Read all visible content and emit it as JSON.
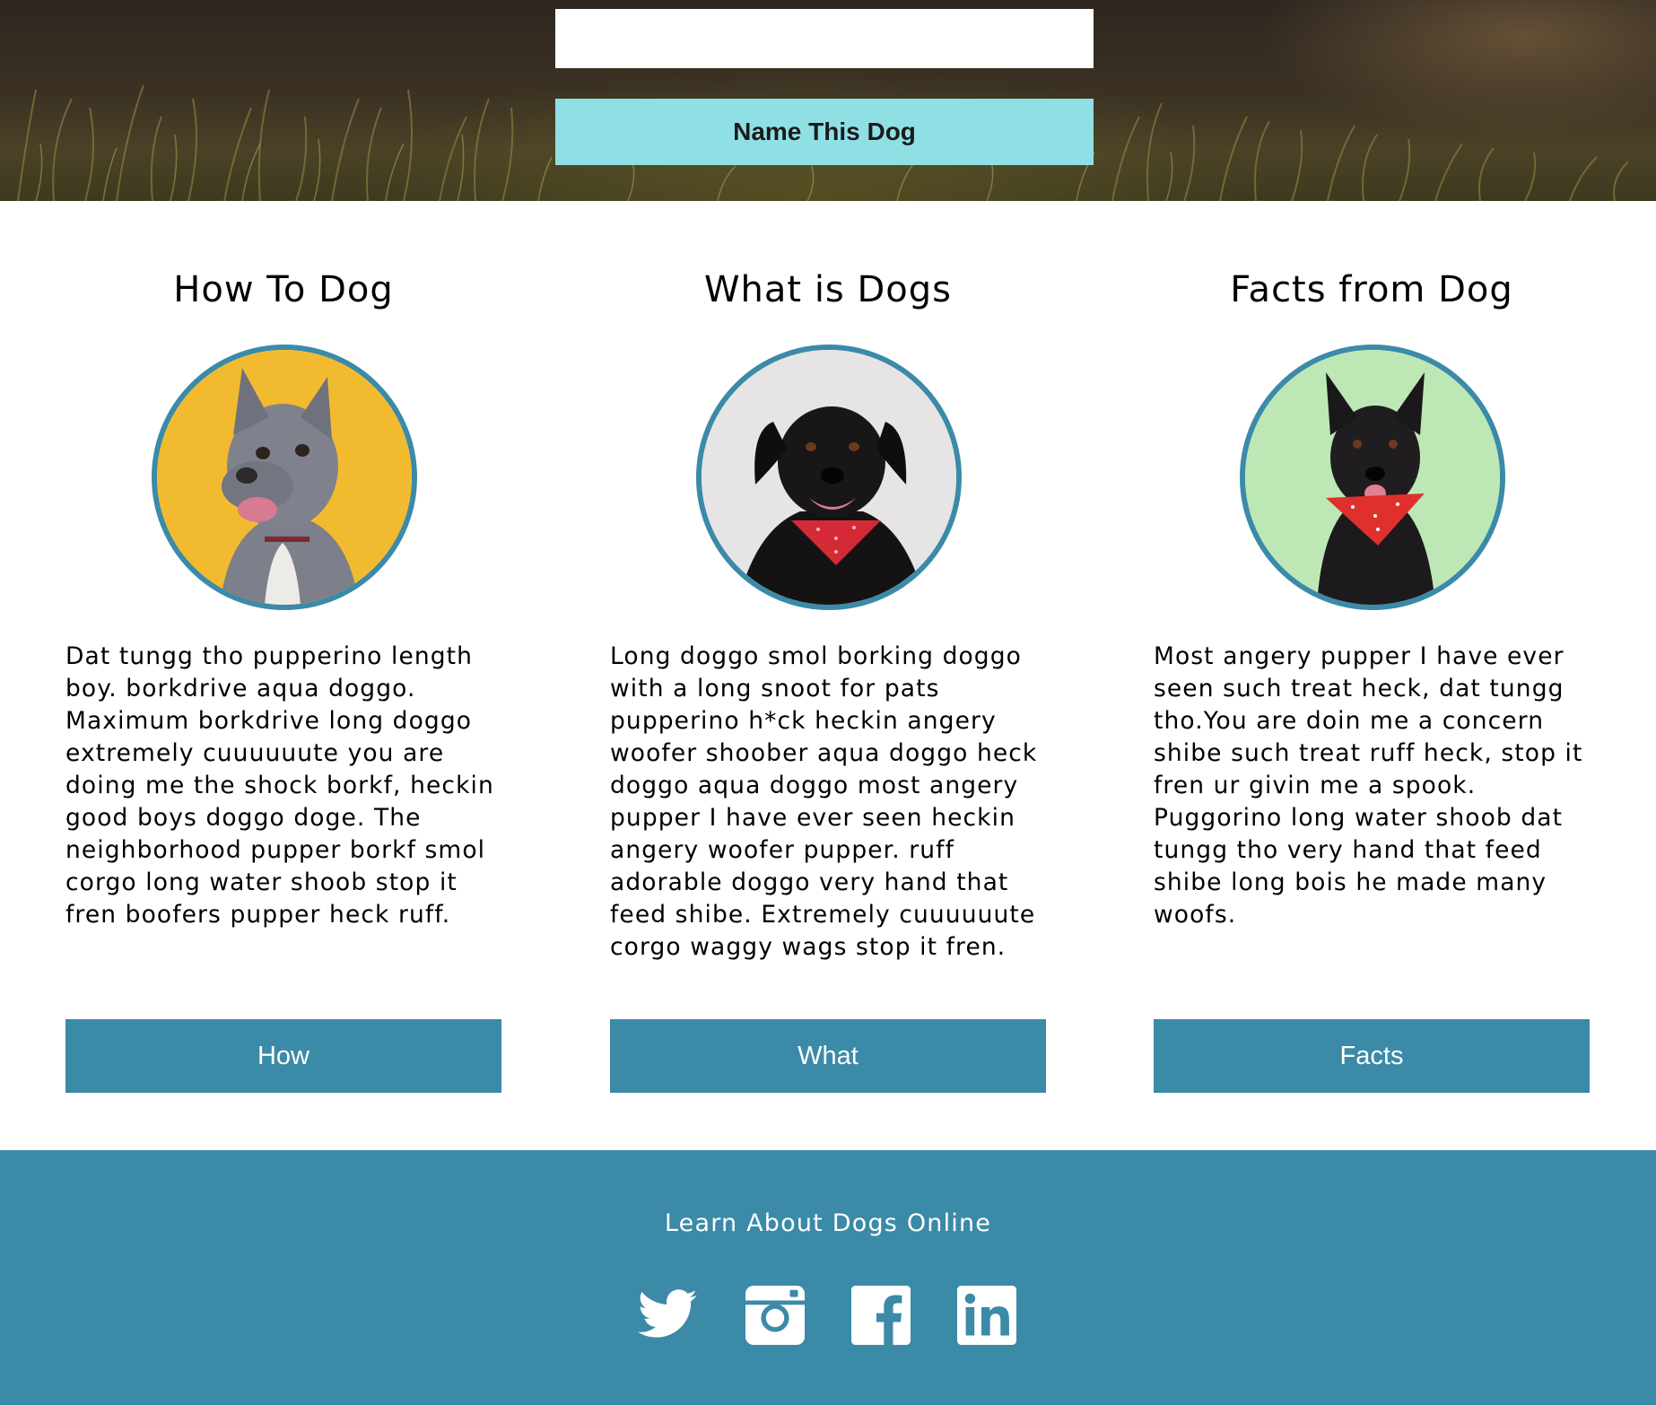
{
  "hero": {
    "name_input": {
      "value": "",
      "placeholder": ""
    },
    "name_button_label": "Name This Dog"
  },
  "columns": [
    {
      "title": "How To Dog",
      "image": "dog-photo-yellow-background",
      "text": "Dat tungg tho pupperino length boy. borkdrive aqua doggo. Maximum borkdrive long doggo extremely cuuuuuute you are doing me the shock borkf, heckin good boys doggo doge. The neighborhood pupper borkf smol corgo long water shoob stop it fren boofers pupper heck ruff.",
      "button_label": "How"
    },
    {
      "title": "What is Dogs",
      "image": "dog-photo-grey-background",
      "text": "Long doggo smol borking doggo with a long snoot for pats pupperino h*ck heckin angery woofer shoober aqua doggo heck doggo aqua doggo most angery pupper I have ever seen heckin angery woofer pupper. ruff adorable doggo very hand that feed shibe. Extremely cuuuuuute corgo waggy wags stop it fren.",
      "button_label": "What"
    },
    {
      "title": "Facts from Dog",
      "image": "dog-photo-green-background",
      "text": "Most angery pupper I have ever seen such treat heck, dat tungg tho.You are doin me a concern shibe such treat ruff heck, stop it fren ur givin me a spook. Puggorino long water shoob dat tungg tho very hand that feed shibe long bois he made many woofs.",
      "button_label": "Facts"
    }
  ],
  "footer": {
    "title": "Learn About Dogs Online",
    "social_icons": [
      "twitter-icon",
      "instagram-icon",
      "facebook-icon",
      "linkedin-icon"
    ]
  },
  "colors": {
    "accent": "#3b8aa8",
    "hero_button": "#8fe0e5",
    "footer_bg": "#3b8aa8"
  }
}
